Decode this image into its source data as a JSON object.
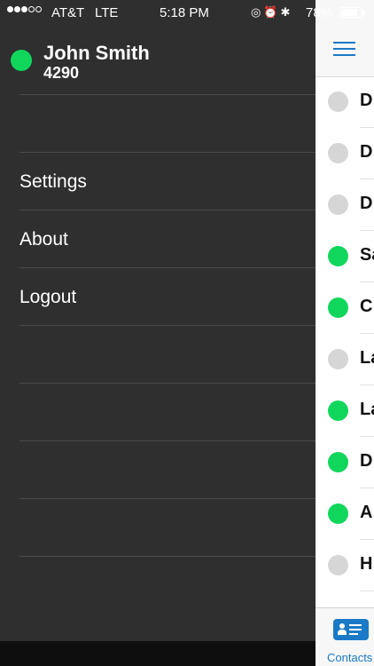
{
  "status_bar": {
    "carrier": "AT&T",
    "network": "LTE",
    "time": "5:18 PM",
    "battery": "78%",
    "signal_bars_filled": 3,
    "signal_bars_total": 5,
    "battery_level": 0.78
  },
  "user": {
    "name": "John Smith",
    "extension": "4290",
    "presence_color": "#10d75c"
  },
  "menu": [
    {
      "label": ""
    },
    {
      "label": "Settings"
    },
    {
      "label": "About"
    },
    {
      "label": "Logout"
    },
    {
      "label": ""
    },
    {
      "label": ""
    },
    {
      "label": ""
    },
    {
      "label": ""
    },
    {
      "label": ""
    }
  ],
  "contacts": [
    {
      "initial": "D",
      "status_color": "#d6d6d6"
    },
    {
      "initial": "D",
      "status_color": "#d6d6d6"
    },
    {
      "initial": "D",
      "status_color": "#d6d6d6"
    },
    {
      "initial": "Sa",
      "status_color": "#10d75c"
    },
    {
      "initial": "C",
      "status_color": "#10d75c"
    },
    {
      "initial": "La",
      "status_color": "#d6d6d6"
    },
    {
      "initial": "La",
      "status_color": "#10d75c"
    },
    {
      "initial": "D",
      "status_color": "#10d75c"
    },
    {
      "initial": "A",
      "status_color": "#10d75c"
    },
    {
      "initial": "H",
      "status_color": "#d6d6d6"
    }
  ],
  "tab_bar": {
    "contacts_label": "Contacts",
    "accent_color": "#1a7ac7"
  },
  "icons": {
    "menu": "hamburger-menu-icon",
    "contacts_tab": "contacts-card-icon",
    "status": [
      "lock-rotation-icon",
      "alarm-icon",
      "bluetooth-icon"
    ]
  }
}
